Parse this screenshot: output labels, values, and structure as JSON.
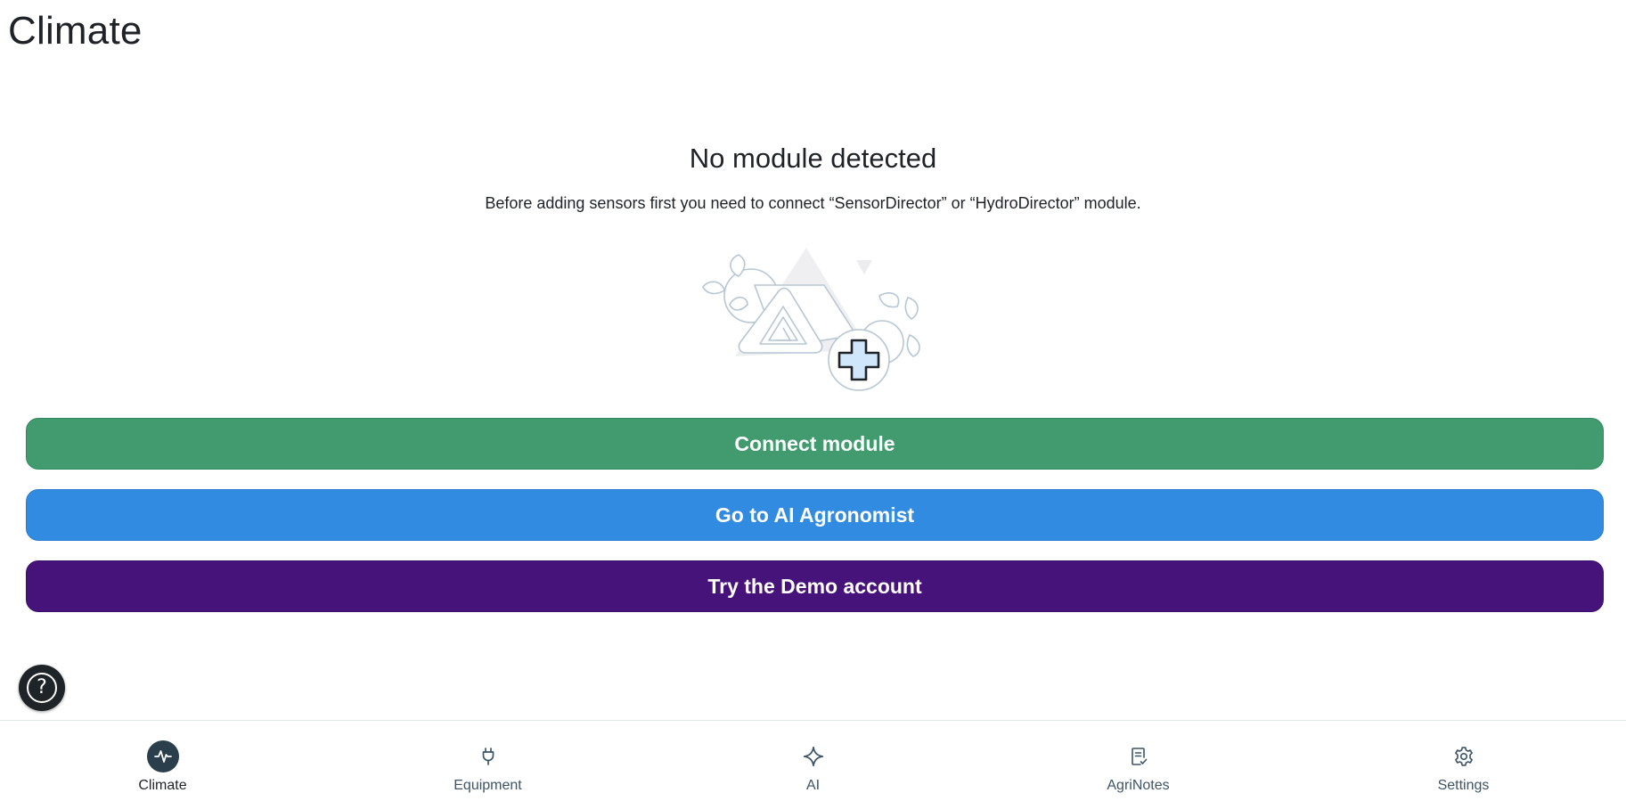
{
  "page": {
    "title": "Climate"
  },
  "empty_state": {
    "title": "No module detected",
    "description": "Before adding sensors first you need to connect “SensorDirector” or “HydroDirector” module.",
    "illustration": "module-plus-illustration"
  },
  "actions": {
    "connect_label": "Connect module",
    "ai_label": "Go to AI Agronomist",
    "demo_label": "Try the Demo account"
  },
  "colors": {
    "connect": "#419b6f",
    "ai": "#318be1",
    "demo": "#45137a",
    "nav_active": "#2b3e4c"
  },
  "help": {
    "icon": "question-icon",
    "glyph": "?"
  },
  "nav": {
    "items": [
      {
        "label": "Climate",
        "icon": "pulse-icon",
        "active": true
      },
      {
        "label": "Equipment",
        "icon": "plug-icon",
        "active": false
      },
      {
        "label": "AI",
        "icon": "sparkle-icon",
        "active": false
      },
      {
        "label": "AgriNotes",
        "icon": "notes-icon",
        "active": false
      },
      {
        "label": "Settings",
        "icon": "gear-icon",
        "active": false
      }
    ]
  }
}
